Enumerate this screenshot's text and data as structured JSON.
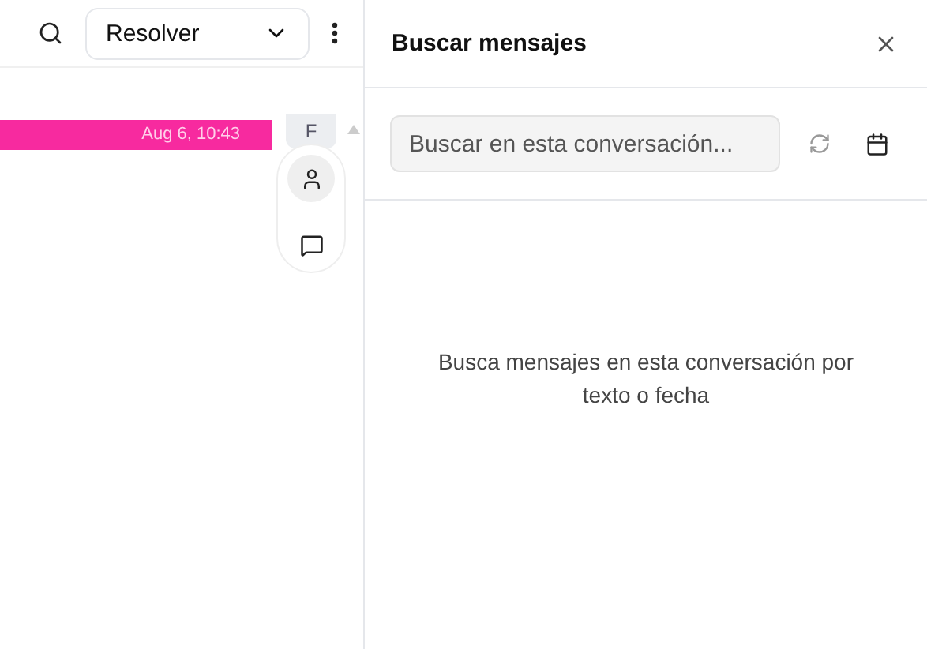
{
  "toolbar": {
    "status_button": "Resolver"
  },
  "conversation": {
    "message_time": "Aug 6, 10:43",
    "avatar_letter": "F"
  },
  "search_panel": {
    "title": "Buscar mensajes",
    "search": {
      "placeholder": "Buscar en esta conversación..."
    },
    "empty_text": "Busca mensajes en esta conversación por texto o fecha"
  }
}
